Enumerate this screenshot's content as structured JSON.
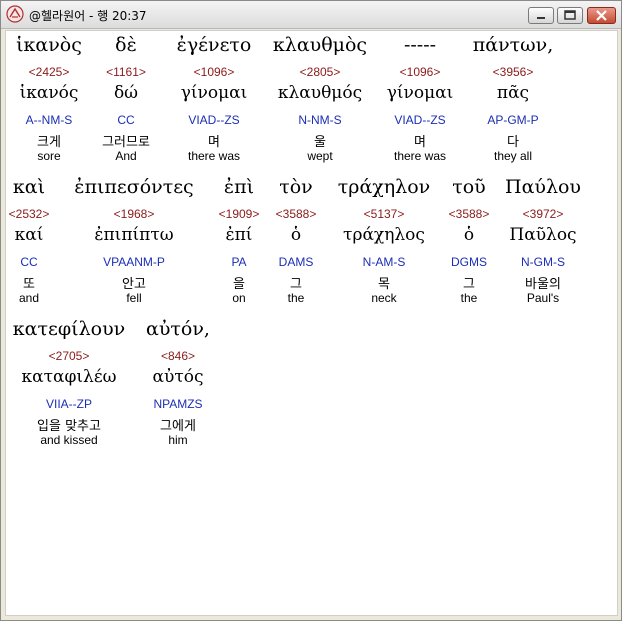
{
  "window": {
    "title": "@헬라원어 - 행 20:37"
  },
  "lines": [
    {
      "words": [
        {
          "greek": "ἱκανὸς",
          "strong": "<2425>",
          "lemma": "ἱκανός",
          "parse": "A--NM-S",
          "korean": "크게",
          "english": "sore"
        },
        {
          "greek": "δὲ",
          "strong": "<1161>",
          "lemma": "δώ",
          "parse": "CC",
          "korean": "그러므로",
          "english": "And"
        },
        {
          "greek": "ἐγένετο",
          "strong": "<1096>",
          "lemma": "γίνομαι",
          "parse": "VIAD--ZS",
          "korean": "며",
          "english": "there was"
        },
        {
          "greek": "κλαυθμὸς",
          "strong": "<2805>",
          "lemma": "κλαυθμός",
          "parse": "N-NM-S",
          "korean": "울",
          "english": "wept"
        },
        {
          "greek": "-----",
          "strong": "<1096>",
          "lemma": "γίνομαι",
          "parse": "VIAD--ZS",
          "korean": "며",
          "english": "there was"
        },
        {
          "greek": "πάντων,",
          "strong": "<3956>",
          "lemma": "πᾶς",
          "parse": "AP-GM-P",
          "korean": "다",
          "english": "they all"
        }
      ]
    },
    {
      "words": [
        {
          "greek": "καὶ",
          "strong": "<2532>",
          "lemma": "καί",
          "parse": "CC",
          "korean": "또",
          "english": "and"
        },
        {
          "greek": "ἐπιπεσόντες",
          "strong": "<1968>",
          "lemma": "ἐπιπίπτω",
          "parse": "VPAANM-P",
          "korean": "안고",
          "english": "fell"
        },
        {
          "greek": "ἐπὶ",
          "strong": "<1909>",
          "lemma": "ἐπί",
          "parse": "PA",
          "korean": "을",
          "english": "on"
        },
        {
          "greek": "τὸν",
          "strong": "<3588>",
          "lemma": "ὁ",
          "parse": "DAMS",
          "korean": "그",
          "english": "the"
        },
        {
          "greek": "τράχηλον",
          "strong": "<5137>",
          "lemma": "τράχηλος",
          "parse": "N-AM-S",
          "korean": "목",
          "english": "neck"
        },
        {
          "greek": "τοῦ",
          "strong": "<3588>",
          "lemma": "ὁ",
          "parse": "DGMS",
          "korean": "그",
          "english": "the"
        },
        {
          "greek": "Παύλου",
          "strong": "<3972>",
          "lemma": "Παῦλος",
          "parse": "N-GM-S",
          "korean": "바울의",
          "english": "Paul's"
        }
      ]
    },
    {
      "words": [
        {
          "greek": "κατεφίλουν",
          "strong": "<2705>",
          "lemma": "καταφιλέω",
          "parse": "VIIA--ZP",
          "korean": "입을 맞추고",
          "english": "and kissed"
        },
        {
          "greek": "αὐτόν,",
          "strong": "<846>",
          "lemma": "αὐτός",
          "parse": "NPAMZS",
          "korean": "그에게",
          "english": "him"
        }
      ]
    }
  ]
}
